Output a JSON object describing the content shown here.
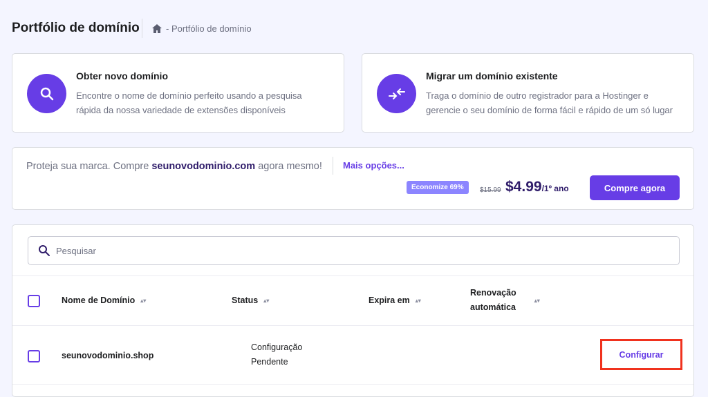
{
  "header": {
    "title": "Portfólio de domínio",
    "breadcrumb": "- Portfólio de domínio"
  },
  "cards": [
    {
      "title": "Obter novo domínio",
      "desc1": "Encontre o nome de domínio perfeito usando a pesquisa",
      "desc2": "rápida da nossa variedade de extensões disponíveis"
    },
    {
      "title": "Migrar um domínio existente",
      "desc1": "Traga o domínio de outro registrador para a Hostinger e",
      "desc2": "gerencie o seu domínio de forma fácil e rápido de um só lugar"
    }
  ],
  "promo": {
    "text_before": "Proteja sua marca. Compre ",
    "domain": "seunovodominio.com",
    "text_after": " agora mesmo!",
    "more": "Mais opções...",
    "badge": "Economize 69%",
    "old_price": "$15.99",
    "price": "$4.99",
    "per": "/1º ano",
    "buy": "Compre agora"
  },
  "search": {
    "placeholder": "Pesquisar"
  },
  "table": {
    "headers": [
      "Nome de Domínio",
      "Status",
      "Expira em",
      "Renovação",
      "automática"
    ],
    "rows": [
      {
        "domain": "seunovodominio.shop",
        "status1": "Configuração",
        "status2": "Pendente",
        "action": "Configurar"
      }
    ]
  },
  "colors": {
    "accent": "#673de6",
    "highlight": "#f0321e"
  }
}
